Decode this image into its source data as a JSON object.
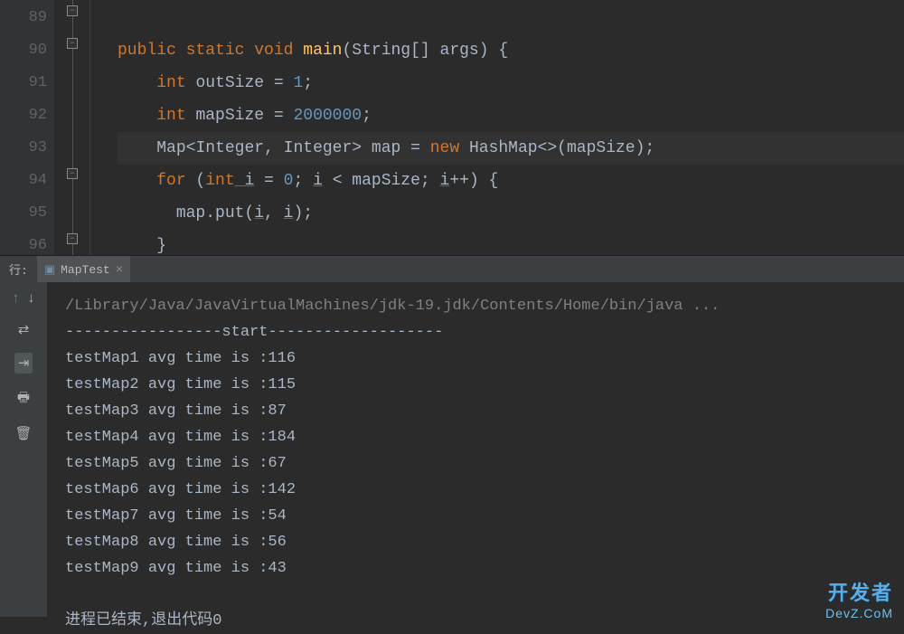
{
  "gutter": [
    "89",
    "90",
    "91",
    "92",
    "93",
    "94",
    "95",
    "96"
  ],
  "code": {
    "line90": {
      "kw1": "public",
      "kw2": "static",
      "kw3": "void",
      "method": "main",
      "params": "(String[] args)",
      "brace": " {"
    },
    "line91": {
      "kw": "int",
      "var": "outSize",
      "eq": " = ",
      "val": "1",
      "semi": ";"
    },
    "line92": {
      "kw": "int",
      "var": "mapSize",
      "eq": " = ",
      "val": "2000000",
      "semi": ";"
    },
    "line93": {
      "type1": "Map",
      "lt": "<",
      "type2": "Integer",
      "comma": ", ",
      "type3": "Integer",
      "gt": ">",
      "var": " map = ",
      "kw": "new",
      "type4": " HashMap",
      "diamond": "<>",
      "open": "(",
      "arg": "mapSize",
      "close": ");"
    },
    "line94": {
      "kw": "for",
      "open": " (",
      "kw2": "int",
      "var": " i",
      "eq": " = ",
      "zero": "0",
      "semi1": "; ",
      "var2": "i",
      "lt": " < ",
      "var3": "mapSize",
      "semi2": "; ",
      "var4": "i",
      "inc": "++)",
      "brace": " {"
    },
    "line95": {
      "call": "map.put(",
      "arg1": "i",
      "comma": ", ",
      "arg2": "i",
      "close": ");"
    },
    "line96": {
      "brace": "}"
    }
  },
  "panel": {
    "run_label": "行:",
    "tab_name": "MapTest"
  },
  "console": {
    "path": "/Library/Java/JavaVirtualMachines/jdk-19.jdk/Contents/Home/bin/java ...",
    "start": "-----------------start-------------------",
    "results": [
      "testMap1 avg time is :116",
      "testMap2 avg time is :115",
      "testMap3 avg time is :87",
      "testMap4 avg time is :184",
      "testMap5 avg time is :67",
      "testMap6 avg time is :142",
      "testMap7 avg time is :54",
      "testMap8 avg time is :56",
      "testMap9 avg time is :43"
    ],
    "exit": "进程已结束,退出代码0"
  },
  "watermark": {
    "line1": "开发者",
    "line2": "DevZ.CoM"
  }
}
